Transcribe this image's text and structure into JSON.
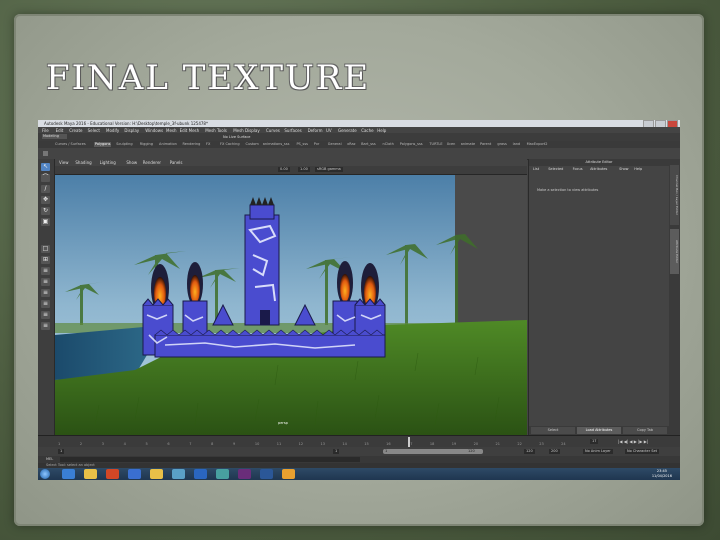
{
  "slide": {
    "title": "FINAL TEXTURE"
  },
  "window": {
    "title": "Autodesk Maya 2016 - Educational Version: H:\\Desktop\\temple_3f-ubunk 125478*"
  },
  "menus": [
    "File",
    "Edit",
    "Create",
    "Select",
    "Modify",
    "Display",
    "Windows",
    "Mesh",
    "Edit Mesh",
    "Mesh Tools",
    "Mesh Display",
    "Curves",
    "Surfaces",
    "Deform",
    "UV",
    "Generate",
    "Cache",
    "Help"
  ],
  "status": {
    "mode": "Modeling",
    "live_surface": "No Live Surface"
  },
  "shelf_tabs": [
    "Curves / Surfaces",
    "Polygons",
    "Sculpting",
    "Rigging",
    "Animation",
    "Rendering",
    "FX",
    "FX Caching",
    "Custom",
    "animations_sss",
    "PS_sss",
    "Pxr",
    "General",
    "xRaz",
    "Bart_sss",
    "nCloth",
    "Polygons_sss",
    "TURTLE",
    "Xcen",
    "animate",
    "Parent",
    "grass",
    "land",
    "MaxExport2"
  ],
  "active_shelf_tab": 1,
  "panel_menu": [
    "View",
    "Shading",
    "Lighting",
    "Show",
    "Renderer",
    "Panels"
  ],
  "panel_fields": {
    "near": "0.00",
    "far": "1.00",
    "color_space": "sRGB gamma"
  },
  "viewport": {
    "camera_label": "persp"
  },
  "attribute_editor": {
    "title": "Attribute Editor",
    "menu": [
      "List",
      "Selected",
      "Focus",
      "Attributes",
      "Show",
      "Help"
    ],
    "message": "Make a selection to view attributes",
    "buttons": [
      "Select",
      "Load Attributes",
      "Copy Tab"
    ],
    "active_button": 1,
    "side_tabs": [
      "Channel Box / Layer Editor",
      "Attribute Editor"
    ]
  },
  "timeline": {
    "ticks": [
      "1",
      "2",
      "3",
      "4",
      "5",
      "6",
      "7",
      "8",
      "9",
      "10",
      "11",
      "12",
      "13",
      "14",
      "15",
      "16",
      "17",
      "18",
      "19",
      "20",
      "21",
      "22",
      "23",
      "24"
    ],
    "current_frame": "17"
  },
  "range": {
    "start": "1",
    "inner_start": "1",
    "inner_end": "120",
    "end": "120",
    "max_end": "200",
    "anim_layer": "No Anim Layer",
    "char_set": "No Character Set"
  },
  "command_line": {
    "label": "MEL"
  },
  "help_line": {
    "text": "Select Tool: select an object"
  },
  "taskbar": {
    "time": "23:45",
    "date": "11/04/2016"
  },
  "colors": {
    "sky_top": "#4c7fa8",
    "sky_bottom": "#a9cbe0",
    "grass": "#3d6b1d",
    "castle_blue": "#4a4ccf",
    "accent_blue": "#5285c4"
  }
}
